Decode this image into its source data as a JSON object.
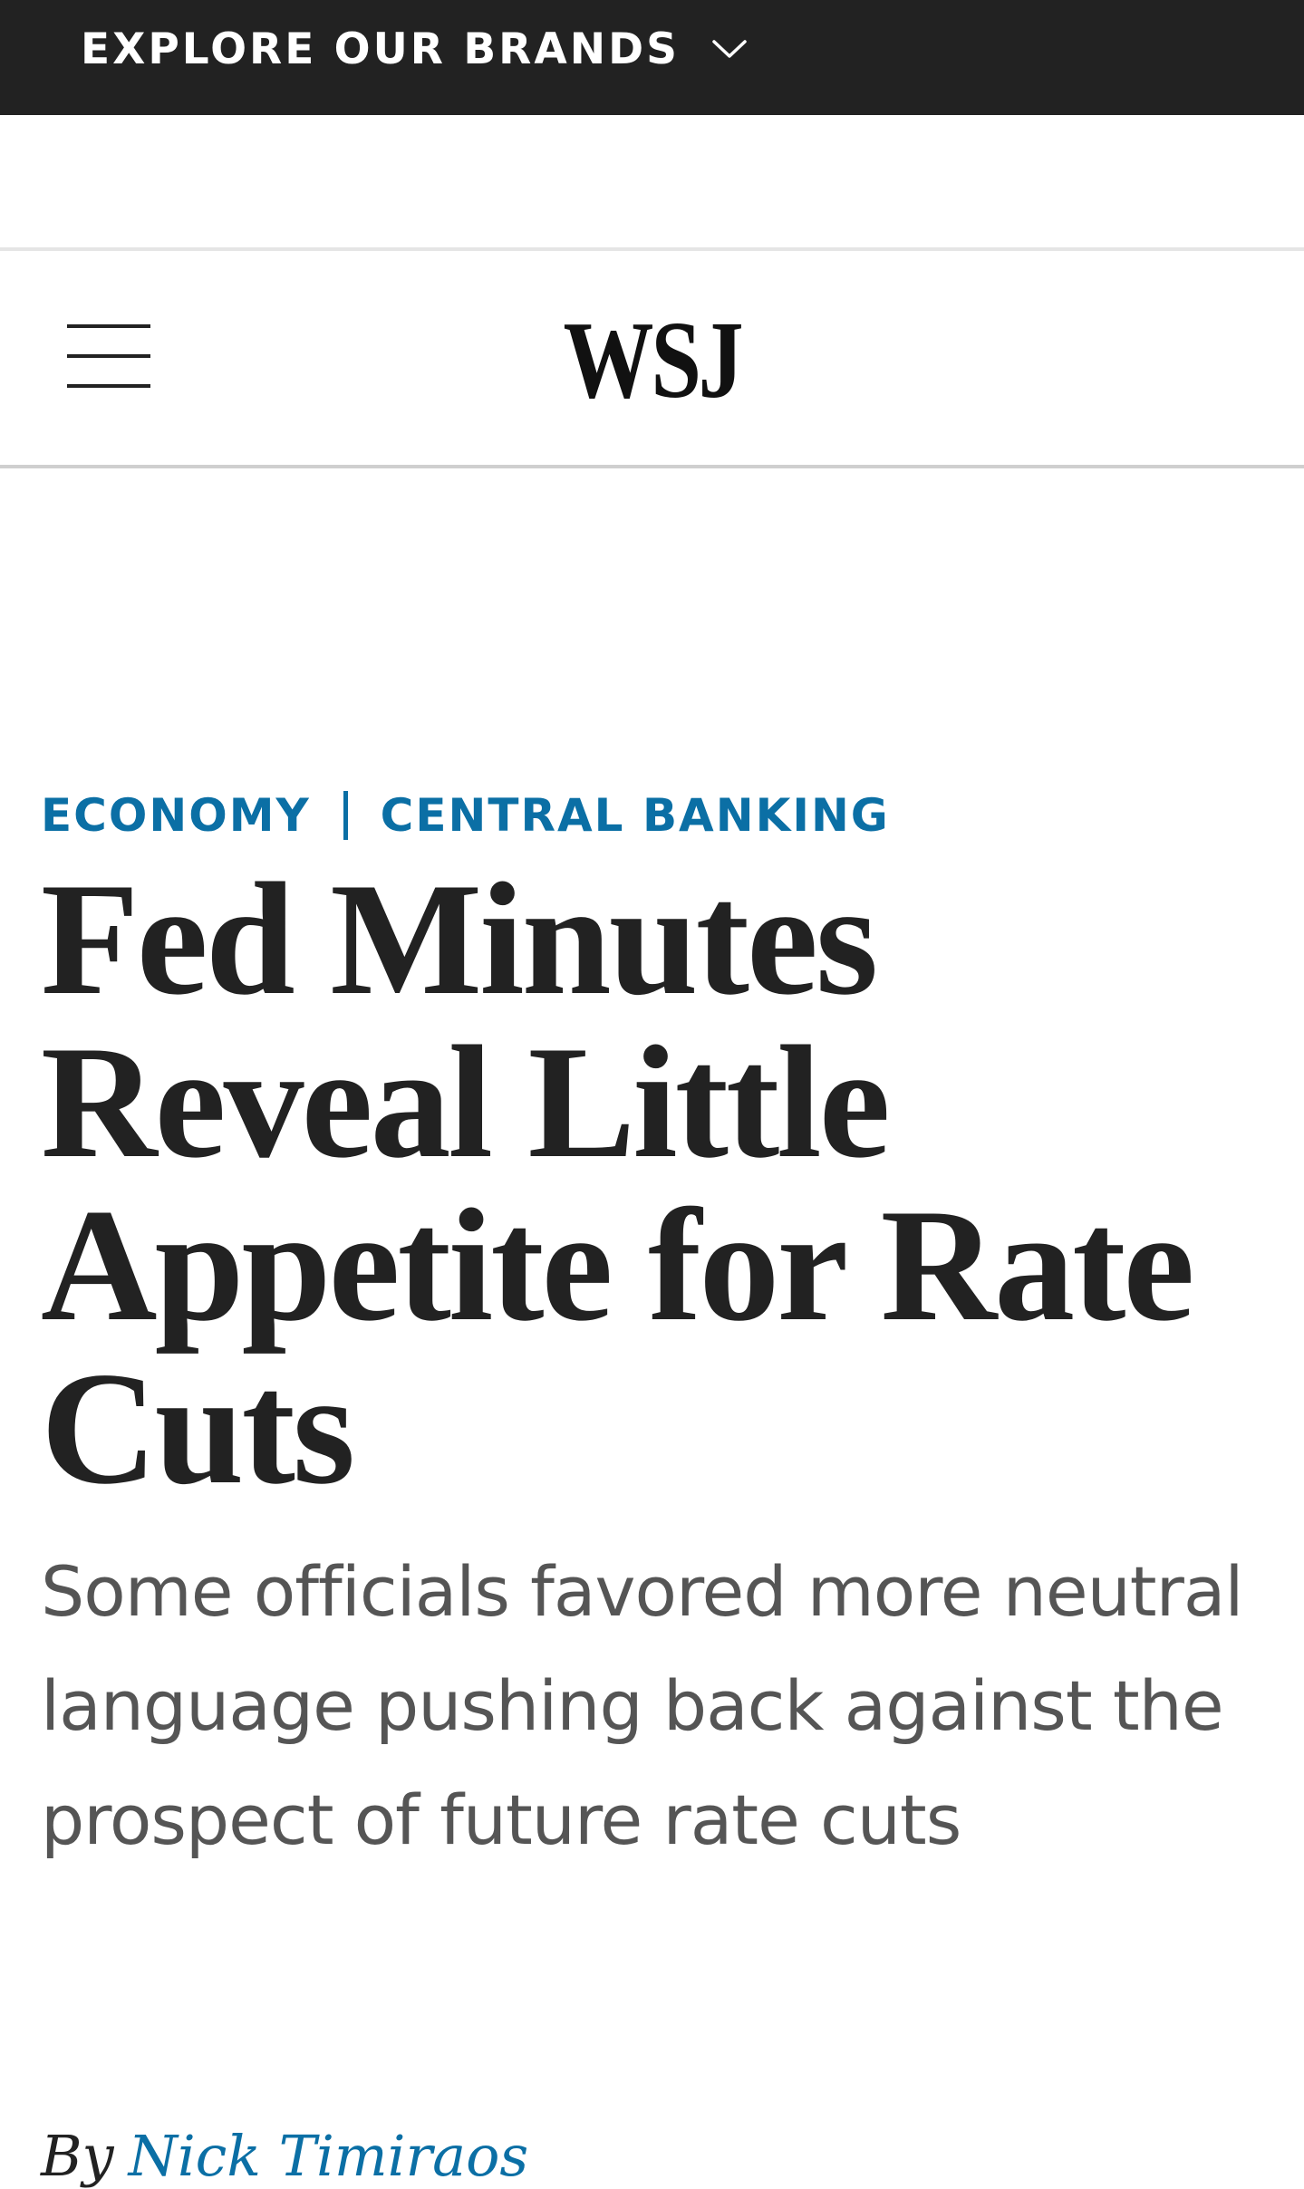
{
  "top_bar": {
    "brands_label": "EXPLORE OUR BRANDS",
    "chevron_icon": "chevron-down-icon"
  },
  "header": {
    "logo_text": "WSJ",
    "menu_icon": "hamburger-menu-icon"
  },
  "article": {
    "kicker": {
      "section": "ECONOMY",
      "subsection": "CENTRAL BANKING"
    },
    "headline": "Fed Minutes Reveal Little Appetite for Rate Cuts",
    "dek": "Some officials favored more neutral language pushing back against the prospect of future rate cuts",
    "byline": {
      "prefix": "By",
      "author": "Nick Timiraos"
    }
  },
  "colors": {
    "top_bar_background": "#222222",
    "link_blue": "#0b6fa5",
    "headline_text": "#222222",
    "dek_text": "#555555"
  }
}
